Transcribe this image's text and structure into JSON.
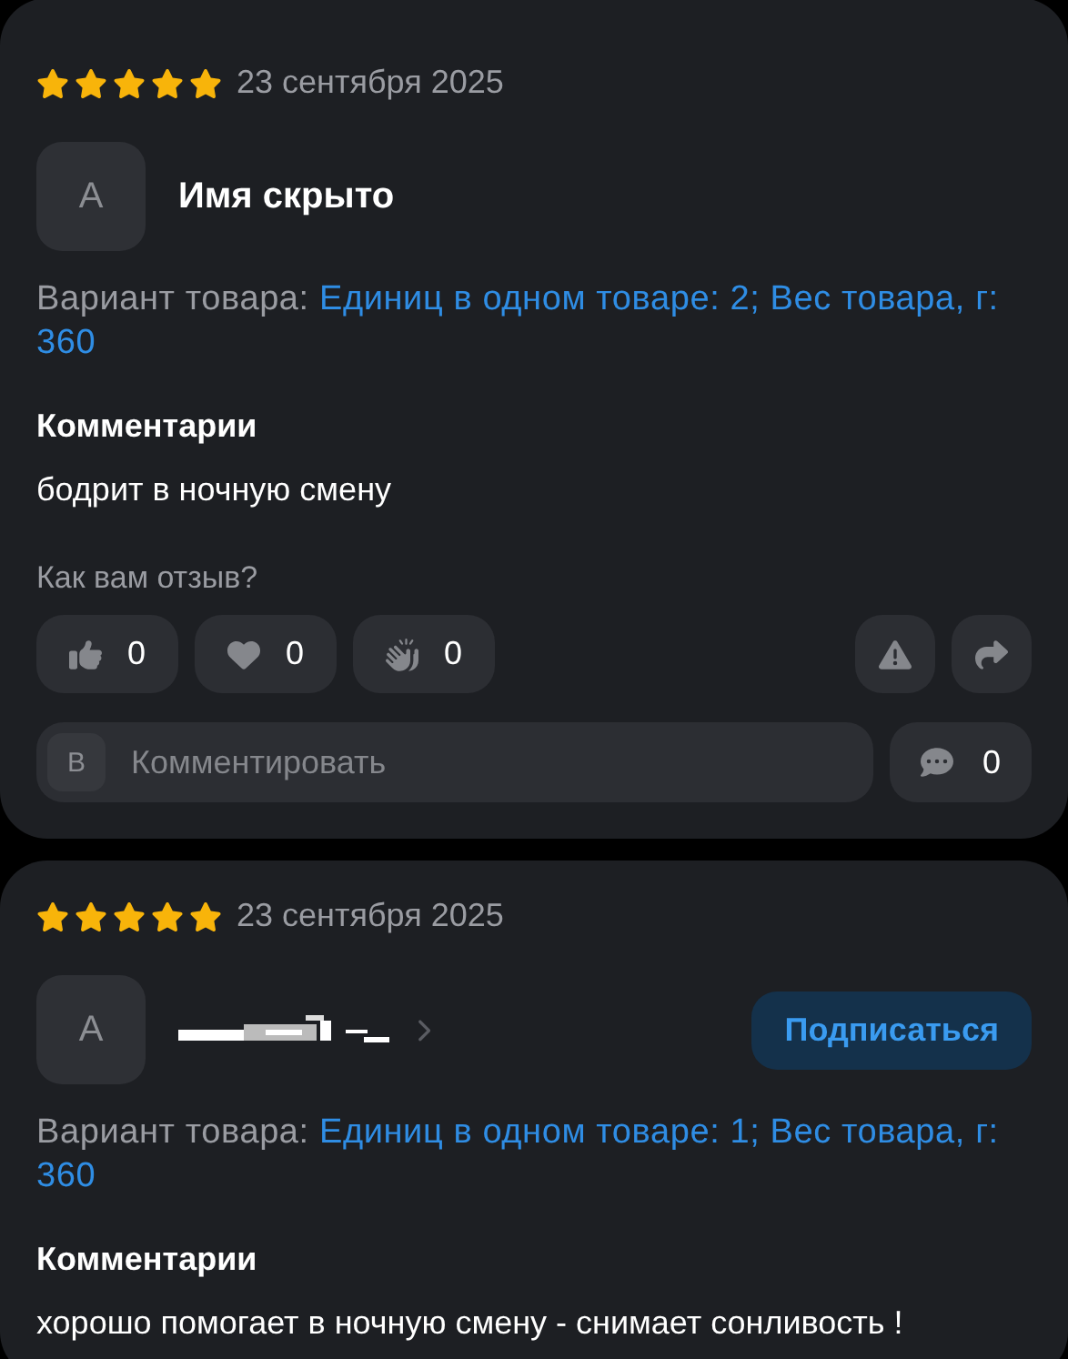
{
  "reviews": [
    {
      "stars": 5,
      "date": "23 сентября 2025",
      "author": {
        "kind": "named",
        "initial": "А",
        "name": "Имя скрыто"
      },
      "variant_label": "Вариант товара:",
      "variant_value": "Единиц в одном товаре: 2; Вес товара, г: 360",
      "comments_heading": "Комментарии",
      "comment": "бодрит в ночную смену",
      "feedback_prompt": "Как вам отзыв?",
      "reactions": [
        {
          "kind": "like",
          "count": "0"
        },
        {
          "kind": "heart",
          "count": "0"
        },
        {
          "kind": "clap",
          "count": "0"
        }
      ],
      "reply": {
        "initial": "В",
        "placeholder": "Комментировать",
        "count": "0"
      }
    },
    {
      "stars": 5,
      "date": "23 сентября 2025",
      "author": {
        "kind": "redacted",
        "initial": "А"
      },
      "subscribe_label": "Подписаться",
      "variant_label": "Вариант товара:",
      "variant_value": "Единиц в одном товаре: 1; Вес товара, г: 360",
      "comments_heading": "Комментарии",
      "comment": "хорошо помогает в ночную смену - снимает сонливость !"
    }
  ]
}
